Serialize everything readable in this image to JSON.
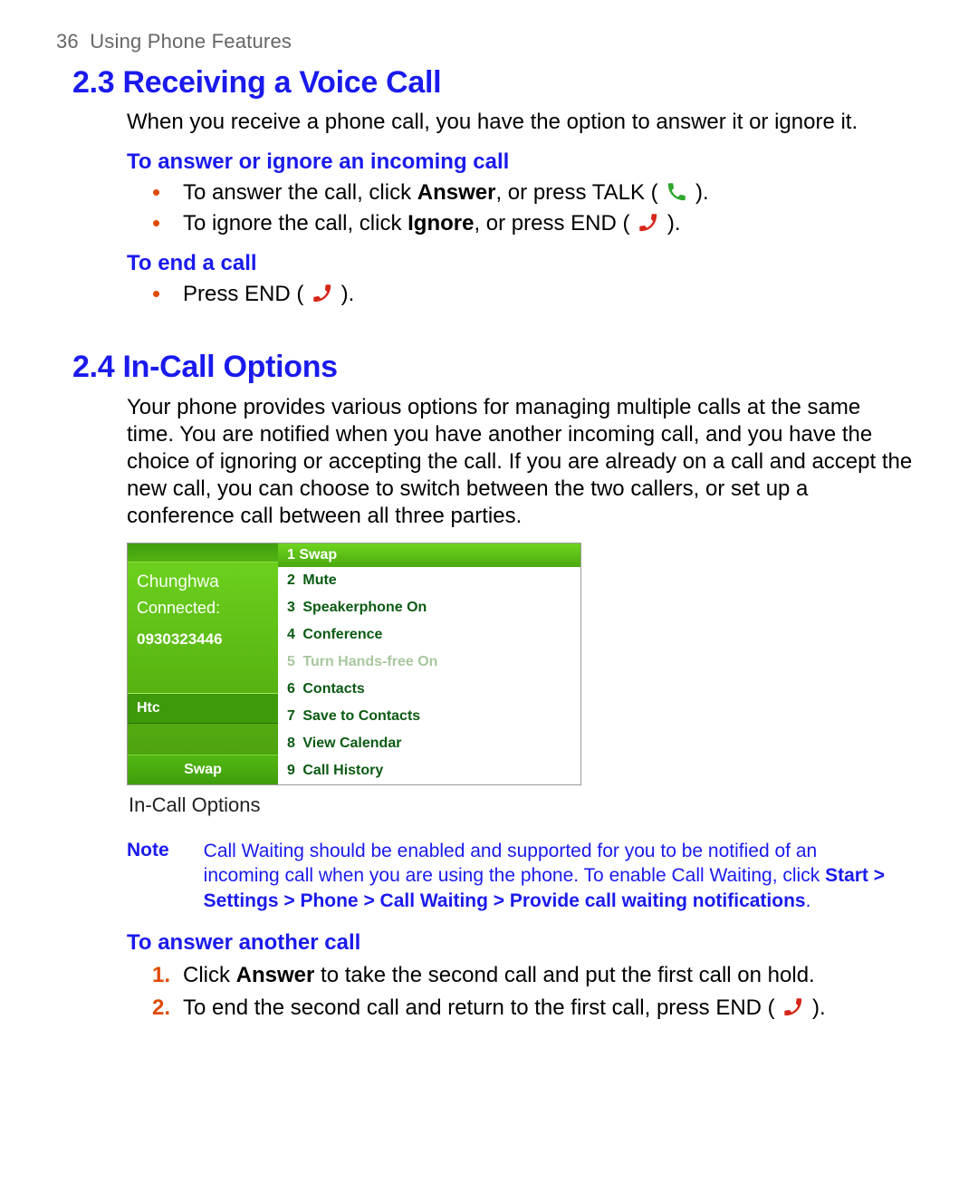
{
  "header": {
    "page_number": "36",
    "running_title": "Using Phone Features"
  },
  "section23": {
    "title": "2.3 Receiving a Voice Call",
    "intro": "When you receive a phone call, you have the option to answer it or ignore it.",
    "sub1_title": "To answer or ignore an incoming call",
    "bullet1_pre": "To answer the call, click ",
    "bullet1_bold": "Answer",
    "bullet1_post1": ", or press TALK ( ",
    "bullet1_post2": " ).",
    "bullet2_pre": "To ignore the call, click ",
    "bullet2_bold": "Ignore",
    "bullet2_post1": ", or press END ( ",
    "bullet2_post2": " ).",
    "sub2_title": "To end a call",
    "bullet3_pre": "Press END ( ",
    "bullet3_post": " )."
  },
  "section24": {
    "title": "2.4 In-Call Options",
    "intro": "Your phone provides various options for managing multiple calls at the same time. You are notified when you have another incoming call, and you have the choice of ignoring or accepting the call. If you are already on a call and accept the new call, you can choose to switch between the two callers, or set up a conference call between all three parties.",
    "caption": "In-Call Options",
    "note_label": "Note",
    "note_text_a": "Call Waiting should be enabled and supported for you to be notified of an incoming call when you are using the phone. To enable Call Waiting, click ",
    "note_path": "Start > Settings > Phone > Call Waiting > Provide call waiting notifications",
    "note_text_b": ".",
    "sub_title": "To answer another call",
    "step1_pre": "Click ",
    "step1_bold": "Answer",
    "step1_post": " to take the second call and put the first call on hold.",
    "step2_pre": "To end the second call and return to the first call, press END ( ",
    "step2_post": " )."
  },
  "screenshot": {
    "carrier": "Chunghwa",
    "connected": "Connected:",
    "number": "0930323446",
    "htc": "Htc",
    "swap": "Swap",
    "menu": [
      {
        "n": "1",
        "label": "Swap",
        "hl": true
      },
      {
        "n": "2",
        "label": "Mute"
      },
      {
        "n": "3",
        "label": "Speakerphone On"
      },
      {
        "n": "4",
        "label": "Conference"
      },
      {
        "n": "5",
        "label": "Turn Hands-free On",
        "disabled": true
      },
      {
        "n": "6",
        "label": "Contacts"
      },
      {
        "n": "7",
        "label": "Save to Contacts"
      },
      {
        "n": "8",
        "label": "View Calendar"
      },
      {
        "n": "9",
        "label": "Call History"
      }
    ]
  }
}
